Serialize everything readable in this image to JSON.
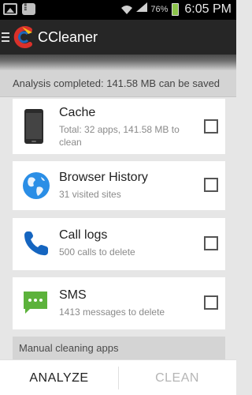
{
  "status_bar": {
    "battery_percent": "76%",
    "time": "6:05 PM",
    "icons": [
      "gallery-icon",
      "bbm-icon",
      "wifi-icon",
      "signal-icon",
      "battery-icon"
    ]
  },
  "app": {
    "title": "CCleaner",
    "icon": "ccleaner-logo-icon"
  },
  "analysis_banner": "Analysis completed: 141.58 MB can be saved",
  "items": [
    {
      "title": "Cache",
      "subtitle": "Total: 32 apps, 141.58 MB to clean",
      "icon": "phone-device-icon",
      "checked": false
    },
    {
      "title": "Browser History",
      "subtitle": "31 visited sites",
      "icon": "globe-icon",
      "checked": false
    },
    {
      "title": "Call logs",
      "subtitle": "500 calls to delete",
      "icon": "phone-handset-icon",
      "checked": false
    },
    {
      "title": "SMS",
      "subtitle": "1413 messages to delete",
      "icon": "message-bubble-icon",
      "checked": false
    }
  ],
  "manual_banner": "Manual cleaning apps",
  "bottom": {
    "analyze_label": "ANALYZE",
    "clean_label": "CLEAN"
  },
  "colors": {
    "accent_blue": "#1565c0",
    "sms_green": "#5cb23b",
    "globe_blue": "#2a8ee6",
    "disabled_text": "#b5b5b5"
  }
}
